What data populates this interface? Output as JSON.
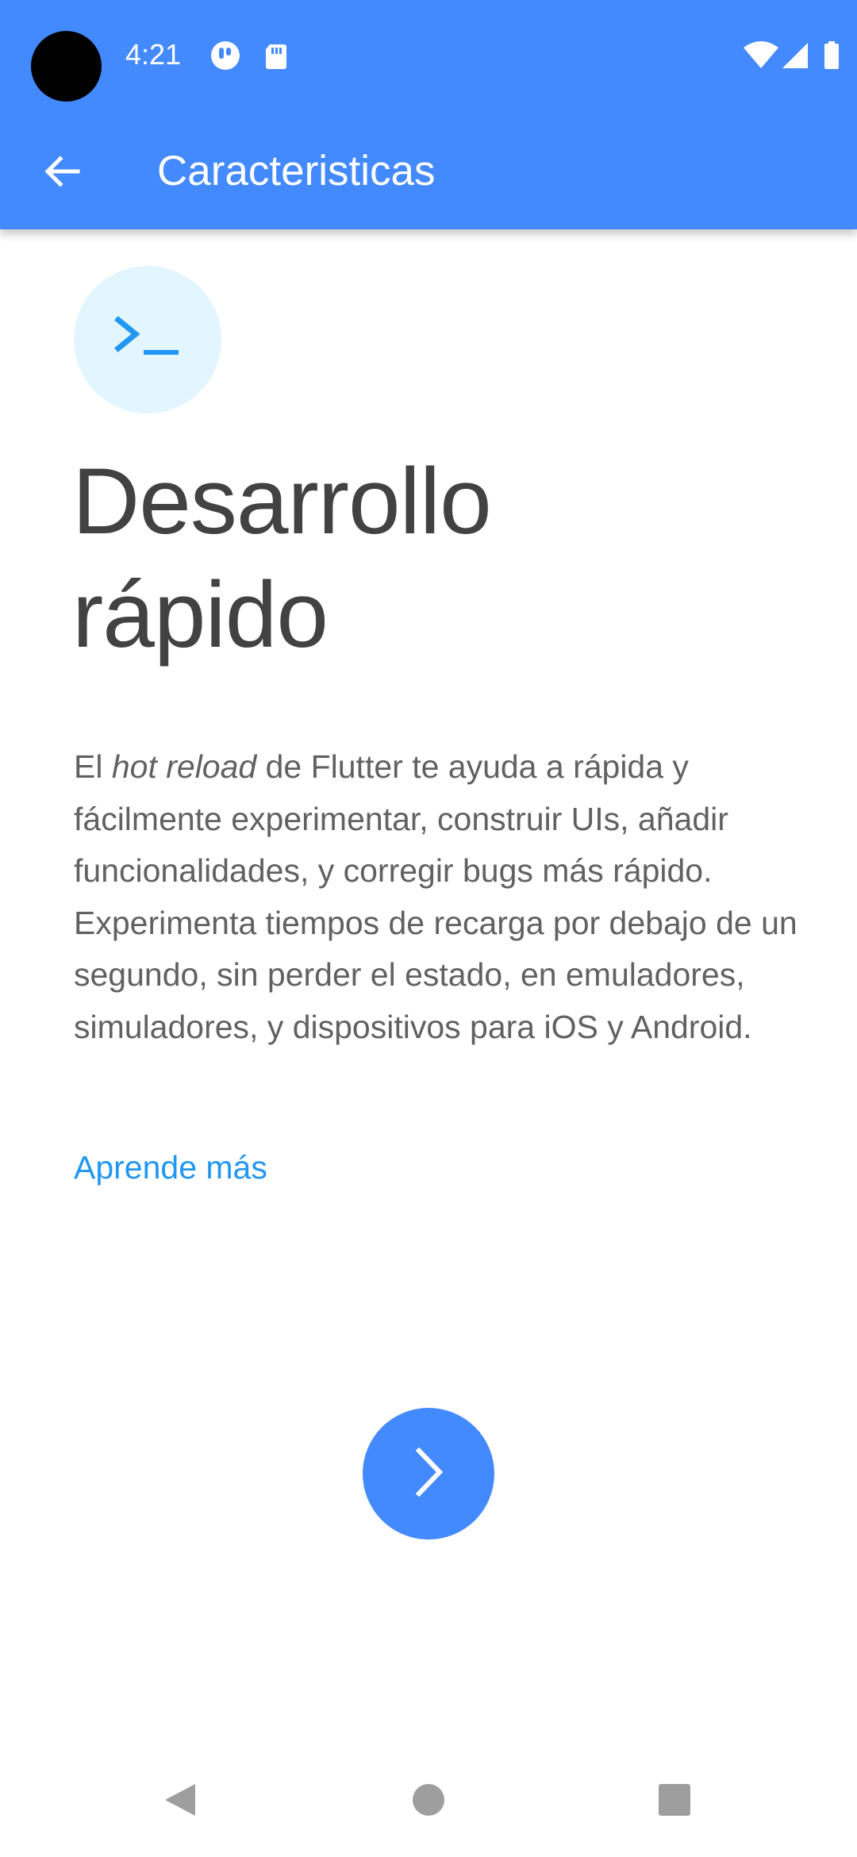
{
  "status_bar": {
    "time": "4:21",
    "icons": [
      "notification-icon",
      "sd-card-icon",
      "wifi-icon",
      "signal-icon",
      "battery-icon"
    ]
  },
  "app_bar": {
    "title": "Caracteristicas",
    "back_icon": "arrow-back-icon",
    "color": "#448aff"
  },
  "feature": {
    "icon": "terminal-icon",
    "icon_bg_color": "#e3f5fe",
    "icon_color": "#2196f3",
    "headline_line1": "Desarrollo",
    "headline_line2": "rápido",
    "description_prefix": "El ",
    "description_emphasis": "hot reload",
    "description_rest": " de Flutter te ayuda a rápida y fácilmente experimentar, construir UIs, añadir funcionalidades, y corregir bugs más rápido. Experimenta tiempos de recarga por debajo de un segundo, sin perder el estado, en emuladores, simuladores, y dispositivos para iOS y Android.",
    "learn_more": "Aprende más",
    "link_color": "#2196f3"
  },
  "next_button": {
    "icon": "chevron-right-icon",
    "color": "#448aff"
  },
  "nav_bar": {
    "icons": [
      "back-triangle-icon",
      "home-circle-icon",
      "recents-square-icon"
    ]
  }
}
